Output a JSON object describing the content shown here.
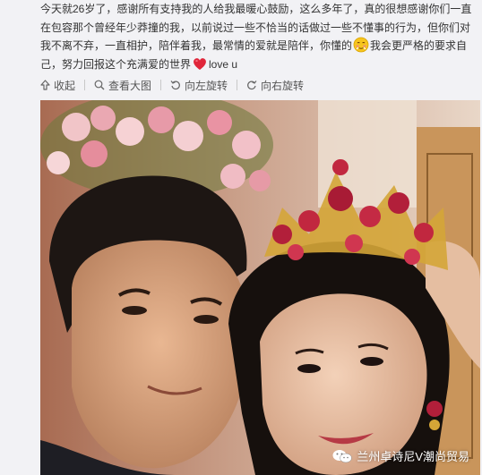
{
  "post": {
    "text_part1": "今天就26岁了，感谢所有支持我的人给我最暖心鼓励，这么多年了，真的很想感谢你们一直在包容那个曾经年少莽撞的我，以前说过一些不恰当的话做过一些不懂事的行为，但你们对我不离不弃，一直相护，陪伴着我，最常情的爱就是陪伴，你懂的",
    "emoji_1": "shy-face-emoji",
    "text_part2": "我会更严格的要求自己，努力回报这个充满爱的世界",
    "emoji_2": "red-heart-emoji",
    "text_part3": "love u"
  },
  "toolbar": {
    "collapse_label": "收起",
    "view_large_label": "查看大图",
    "rotate_left_label": "向左旋转",
    "rotate_right_label": "向右旋转"
  },
  "photo": {
    "watermark_text": "兰州卓诗尼V潮尚贸易"
  },
  "colors": {
    "background": "#f2f2f5",
    "text": "#333333",
    "heart": "#e0263a",
    "emoji_face": "#f7c51e"
  }
}
